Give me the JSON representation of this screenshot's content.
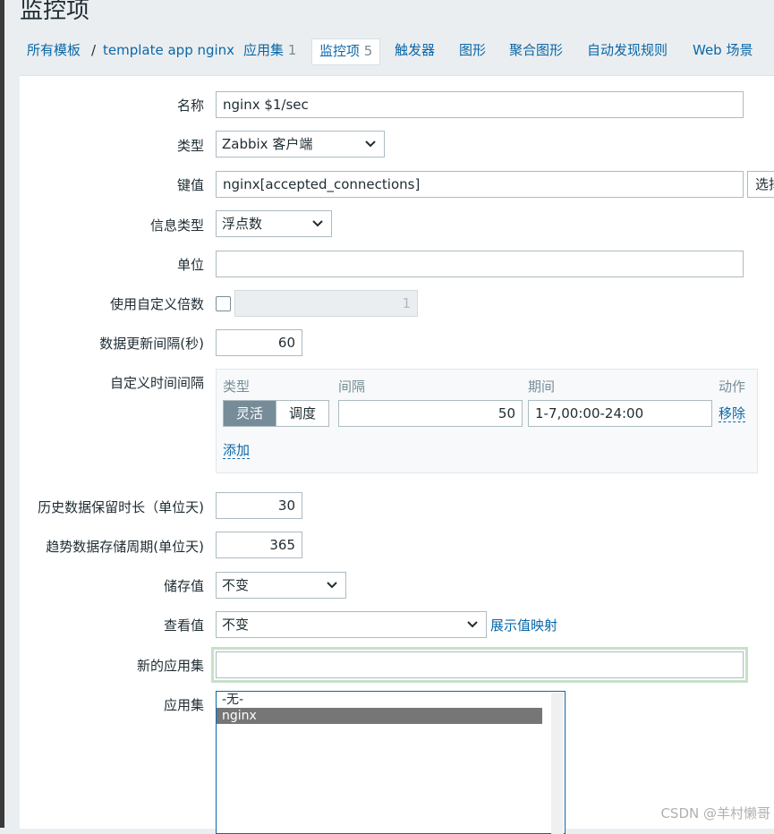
{
  "page": {
    "title": "监控项"
  },
  "tabs": {
    "all_templates": "所有模板",
    "separator": "/",
    "template_name": "template app nginx",
    "applications": "应用集",
    "applications_count": "1",
    "items": "监控项",
    "items_count": "5",
    "triggers": "触发器",
    "graphs": "图形",
    "screens": "聚合图形",
    "discovery": "自动发现规则",
    "web": "Web 场景"
  },
  "form": {
    "name": {
      "label": "名称",
      "value": "nginx $1/sec"
    },
    "type": {
      "label": "类型",
      "value": "Zabbix 客户端"
    },
    "key": {
      "label": "键值",
      "value": "nginx[accepted_connections]",
      "select_button": "选择"
    },
    "value_type": {
      "label": "信息类型",
      "value": "浮点数"
    },
    "units": {
      "label": "单位",
      "value": ""
    },
    "multiplier": {
      "label": "使用自定义倍数",
      "value": "1",
      "checked": false
    },
    "interval": {
      "label": "数据更新间隔(秒)",
      "value": "60"
    },
    "custom_intervals": {
      "label": "自定义时间间隔",
      "col_type": "类型",
      "col_interval": "间隔",
      "col_period": "期间",
      "col_action": "动作",
      "mode_flexible": "灵活",
      "mode_scheduling": "调度",
      "interval_value": "50",
      "period_value": "1-7,00:00-24:00",
      "remove": "移除",
      "add": "添加"
    },
    "history": {
      "label": "历史数据保留时长（单位天)",
      "value": "30"
    },
    "trends": {
      "label": "趋势数据存储周期(单位天)",
      "value": "365"
    },
    "store_value": {
      "label": "储存值",
      "value": "不变"
    },
    "show_value": {
      "label": "查看值",
      "value": "不变",
      "link": "展示值映射"
    },
    "new_application": {
      "label": "新的应用集",
      "value": ""
    },
    "applications": {
      "label": "应用集",
      "options": [
        "-无-",
        "nginx"
      ],
      "selected": "nginx"
    }
  },
  "watermark": "CSDN @羊村懒哥"
}
